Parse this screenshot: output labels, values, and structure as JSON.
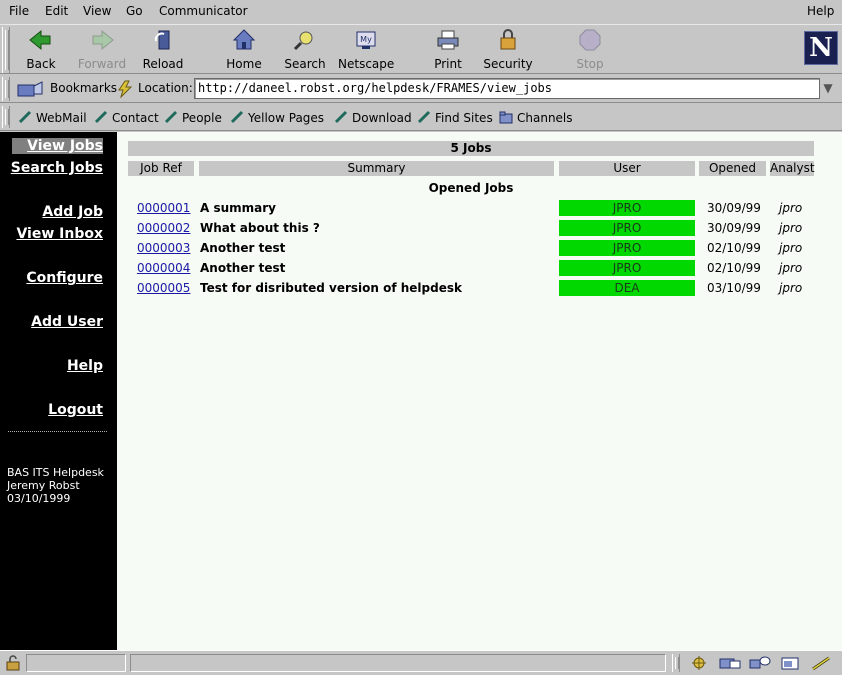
{
  "menu": {
    "items": [
      "File",
      "Edit",
      "View",
      "Go",
      "Communicator"
    ],
    "help": "Help"
  },
  "toolbar": {
    "back": "Back",
    "forward": "Forward",
    "reload": "Reload",
    "home": "Home",
    "search": "Search",
    "netscape": "Netscape",
    "print": "Print",
    "security": "Security",
    "stop": "Stop",
    "logo": "N"
  },
  "location": {
    "bookmarks": "Bookmarks",
    "label": "Location:",
    "url": "http://daneel.robst.org/helpdesk/FRAMES/view_jobs"
  },
  "personal_toolbar": [
    "WebMail",
    "Contact",
    "People",
    "Yellow Pages",
    "Download",
    "Find Sites",
    "Channels"
  ],
  "sidebar": {
    "links": [
      "View Jobs",
      "Search Jobs",
      "Add Job",
      "View Inbox",
      "Configure",
      "Add User",
      "Help",
      "Logout"
    ],
    "active": "View Jobs",
    "info": [
      "BAS ITS Helpdesk",
      "Jeremy Robst",
      "03/10/1999"
    ]
  },
  "jobs": {
    "title": "5 Jobs",
    "columns": [
      "Job Ref",
      "Summary",
      "User",
      "Opened",
      "Analyst"
    ],
    "section": "Opened Jobs",
    "rows": [
      {
        "ref": "0000001",
        "summary": "A summary",
        "user": "JPRO",
        "opened": "30/09/99",
        "analyst": "jpro"
      },
      {
        "ref": "0000002",
        "summary": "What about this ?",
        "user": "JPRO",
        "opened": "30/09/99",
        "analyst": "jpro"
      },
      {
        "ref": "0000003",
        "summary": "Another test",
        "user": "JPRO",
        "opened": "02/10/99",
        "analyst": "jpro"
      },
      {
        "ref": "0000004",
        "summary": "Another test",
        "user": "JPRO",
        "opened": "02/10/99",
        "analyst": "jpro"
      },
      {
        "ref": "0000005",
        "summary": "Test for disributed version of helpdesk",
        "user": "DEA",
        "opened": "03/10/99",
        "analyst": "jpro"
      }
    ]
  },
  "colors": {
    "chrome": "#c6c6c6",
    "sidebar_bg": "#000000",
    "main_bg": "#f6fbf5",
    "user_cell": "#00d800",
    "link": "#1a1aa6"
  }
}
